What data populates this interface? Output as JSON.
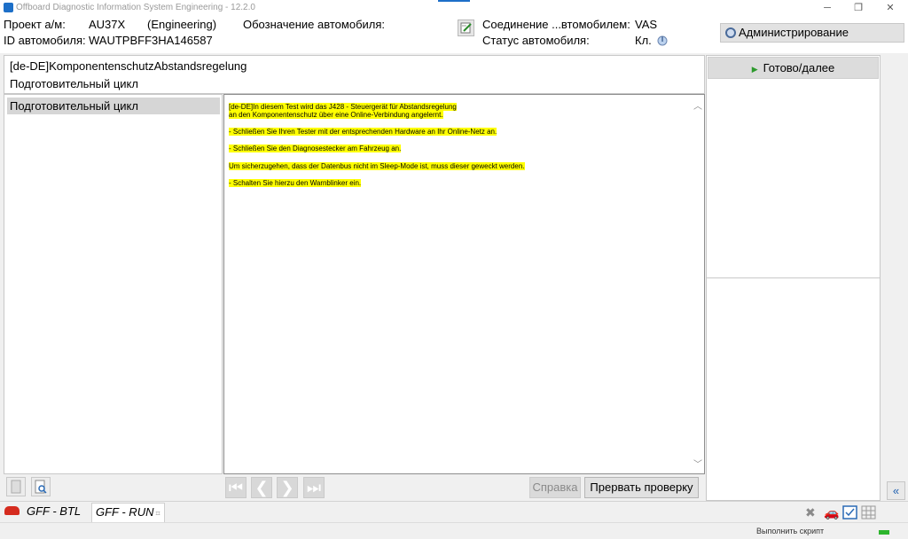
{
  "window": {
    "title": "Offboard Diagnostic Information System Engineering - 12.2.0",
    "controls": [
      "─",
      "❐",
      "✕"
    ]
  },
  "header": {
    "project_label": "Проект а/м:",
    "project_value": "AU37X",
    "project_mode": "(Engineering)",
    "designation_label": "Обозначение автомобиля:",
    "vehicle_id_label": "ID автомобиля:",
    "vehicle_id_value": "WAUTPBFF3HA146587",
    "connection_label": "Соединение ...втомобилем:",
    "connection_value": "VAS",
    "status_label": "Статус автомобиля:",
    "status_value": "Кл.",
    "admin_button": "Администрирование"
  },
  "test": {
    "title": "[de-DE]KomponentenschutzAbstandsregelung",
    "subtitle": "Подготовительный цикл"
  },
  "steps": {
    "items": [
      "Подготовительный цикл"
    ]
  },
  "instructions": [
    "[de-DE]In diesem Test wird das J428 - Steuergerät für Abstandsregelung",
    "an den Komponentenschutz über eine Online-Verbindung angelernt.",
    "- Schließen Sie Ihren Tester mit der entsprechenden Hardware an Ihr Online-Netz an.",
    "- Schließen Sie den Diagnosestecker am Fahrzeug an.",
    "Um sicherzugehen, dass der Datenbus nicht im Sleep-Mode ist, muss dieser geweckt werden.",
    "- Schalten Sie hierzu den Warnblinker ein."
  ],
  "highlight_color": "#ffff00",
  "right": {
    "ready_button": "Готово/далее"
  },
  "nav": {
    "first": "⏮",
    "prev": "❮",
    "next": "❯",
    "last": "⏭"
  },
  "buttons": {
    "help": "Справка",
    "abort": "Прервать проверку"
  },
  "tabs": [
    {
      "label": "GFF - BTL"
    },
    {
      "label": "GFF - RUN",
      "close": "⌗"
    }
  ],
  "statusbar": {
    "text": "Выполнить скрипт"
  }
}
